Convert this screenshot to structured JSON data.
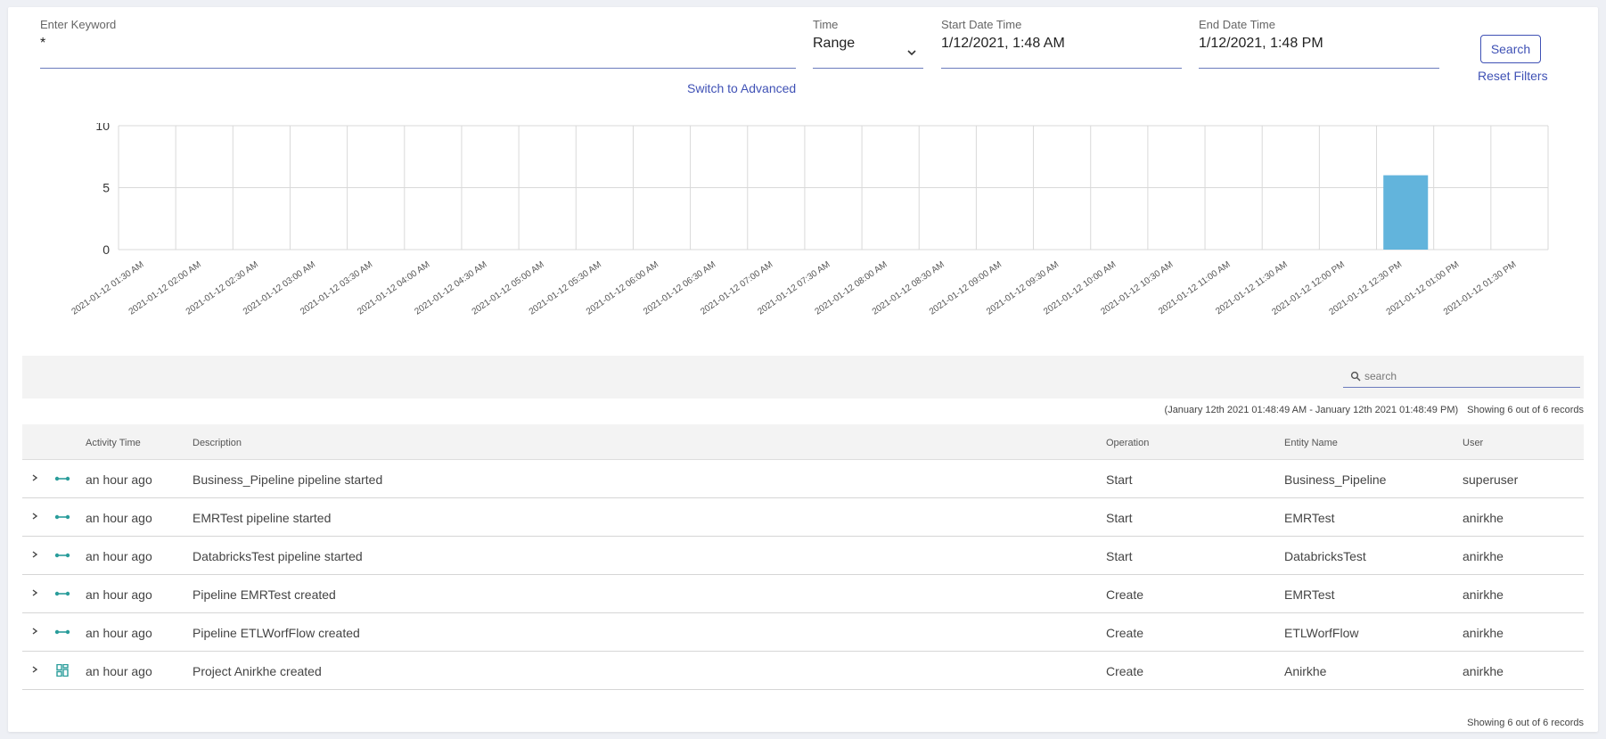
{
  "filters": {
    "keyword": {
      "label": "Enter Keyword",
      "value": "*"
    },
    "time": {
      "label": "Time",
      "value": "Range"
    },
    "start": {
      "label": "Start Date Time",
      "value": "1/12/2021, 1:48 AM"
    },
    "end": {
      "label": "End Date Time",
      "value": "1/12/2021, 1:48 PM"
    },
    "search_label": "Search",
    "reset_label": "Reset Filters",
    "advanced_label": "Switch to Advanced"
  },
  "chart_data": {
    "type": "bar",
    "categories": [
      "2021-01-12 01:30 AM",
      "2021-01-12 02:00 AM",
      "2021-01-12 02:30 AM",
      "2021-01-12 03:00 AM",
      "2021-01-12 03:30 AM",
      "2021-01-12 04:00 AM",
      "2021-01-12 04:30 AM",
      "2021-01-12 05:00 AM",
      "2021-01-12 05:30 AM",
      "2021-01-12 06:00 AM",
      "2021-01-12 06:30 AM",
      "2021-01-12 07:00 AM",
      "2021-01-12 07:30 AM",
      "2021-01-12 08:00 AM",
      "2021-01-12 08:30 AM",
      "2021-01-12 09:00 AM",
      "2021-01-12 09:30 AM",
      "2021-01-12 10:00 AM",
      "2021-01-12 10:30 AM",
      "2021-01-12 11:00 AM",
      "2021-01-12 11:30 AM",
      "2021-01-12 12:00 PM",
      "2021-01-12 12:30 PM",
      "2021-01-12 01:00 PM",
      "2021-01-12 01:30 PM"
    ],
    "values": [
      0,
      0,
      0,
      0,
      0,
      0,
      0,
      0,
      0,
      0,
      0,
      0,
      0,
      0,
      0,
      0,
      0,
      0,
      0,
      0,
      0,
      0,
      6,
      0,
      0
    ],
    "yticks": [
      0,
      5,
      10
    ],
    "ylim": [
      0,
      10
    ],
    "grid": true,
    "bar_color": "#62b4dc"
  },
  "toolbar": {
    "search_placeholder": "search"
  },
  "range_text": "(January 12th 2021 01:48:49 AM - January 12th 2021 01:48:49 PM)",
  "showing_text": "Showing 6 out of 6 records",
  "table": {
    "headers": {
      "time": "Activity Time",
      "desc": "Description",
      "op": "Operation",
      "entity": "Entity Name",
      "user": "User"
    },
    "rows": [
      {
        "icon": "pipeline-icon",
        "time": "an hour ago",
        "desc": "Business_Pipeline pipeline started",
        "op": "Start",
        "entity": "Business_Pipeline",
        "user": "superuser"
      },
      {
        "icon": "pipeline-icon",
        "time": "an hour ago",
        "desc": "EMRTest pipeline started",
        "op": "Start",
        "entity": "EMRTest",
        "user": "anirkhe"
      },
      {
        "icon": "pipeline-icon",
        "time": "an hour ago",
        "desc": "DatabricksTest pipeline started",
        "op": "Start",
        "entity": "DatabricksTest",
        "user": "anirkhe"
      },
      {
        "icon": "pipeline-icon",
        "time": "an hour ago",
        "desc": "Pipeline EMRTest created",
        "op": "Create",
        "entity": "EMRTest",
        "user": "anirkhe"
      },
      {
        "icon": "pipeline-icon",
        "time": "an hour ago",
        "desc": "Pipeline ETLWorfFlow created",
        "op": "Create",
        "entity": "ETLWorfFlow",
        "user": "anirkhe"
      },
      {
        "icon": "project-icon",
        "time": "an hour ago",
        "desc": "Project Anirkhe created",
        "op": "Create",
        "entity": "Anirkhe",
        "user": "anirkhe"
      }
    ]
  },
  "colors": {
    "accent": "#3f51b5",
    "icon": "#2a9d9b"
  }
}
